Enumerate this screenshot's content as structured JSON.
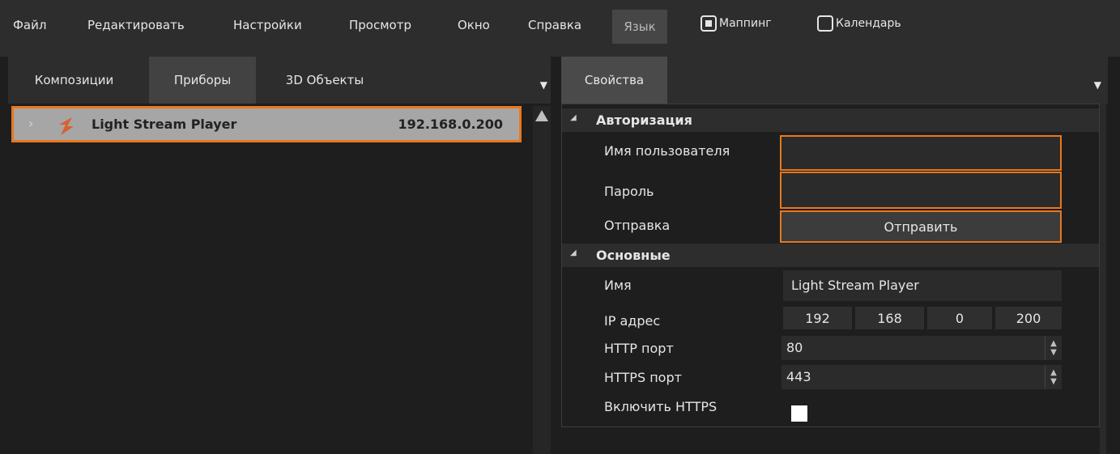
{
  "menu": {
    "items": [
      "Файл",
      "Редактировать",
      "Настройки",
      "Просмотр",
      "Окно",
      "Справка"
    ],
    "language": "Язык",
    "mapping_label": "Маппинг",
    "calendar_label": "Календарь"
  },
  "left_panel": {
    "tabs": [
      "Композиции",
      "Приборы",
      "3D Объекты"
    ],
    "device": {
      "name": "Light Stream Player",
      "ip": "192.168.0.200"
    }
  },
  "right_panel": {
    "tab": "Свойства",
    "auth": {
      "title": "Авторизация",
      "username_label": "Имя пользователя",
      "username_value": "",
      "password_label": "Пароль",
      "password_value": "",
      "send_label": "Отправка",
      "send_button": "Отправить"
    },
    "main": {
      "title": "Основные",
      "name_label": "Имя",
      "name_value": "Light Stream Player",
      "ip_label": "IP адрес",
      "ip_octets": [
        "192",
        "168",
        "0",
        "200"
      ],
      "http_label": "HTTP порт",
      "http_value": "80",
      "https_label": "HTTPS порт",
      "https_value": "443",
      "enable_https_label": "Включить HTTPS"
    }
  },
  "colors": {
    "accent": "#e8781e",
    "background": "#1e1e1e",
    "panel": "#2d2d2d"
  }
}
